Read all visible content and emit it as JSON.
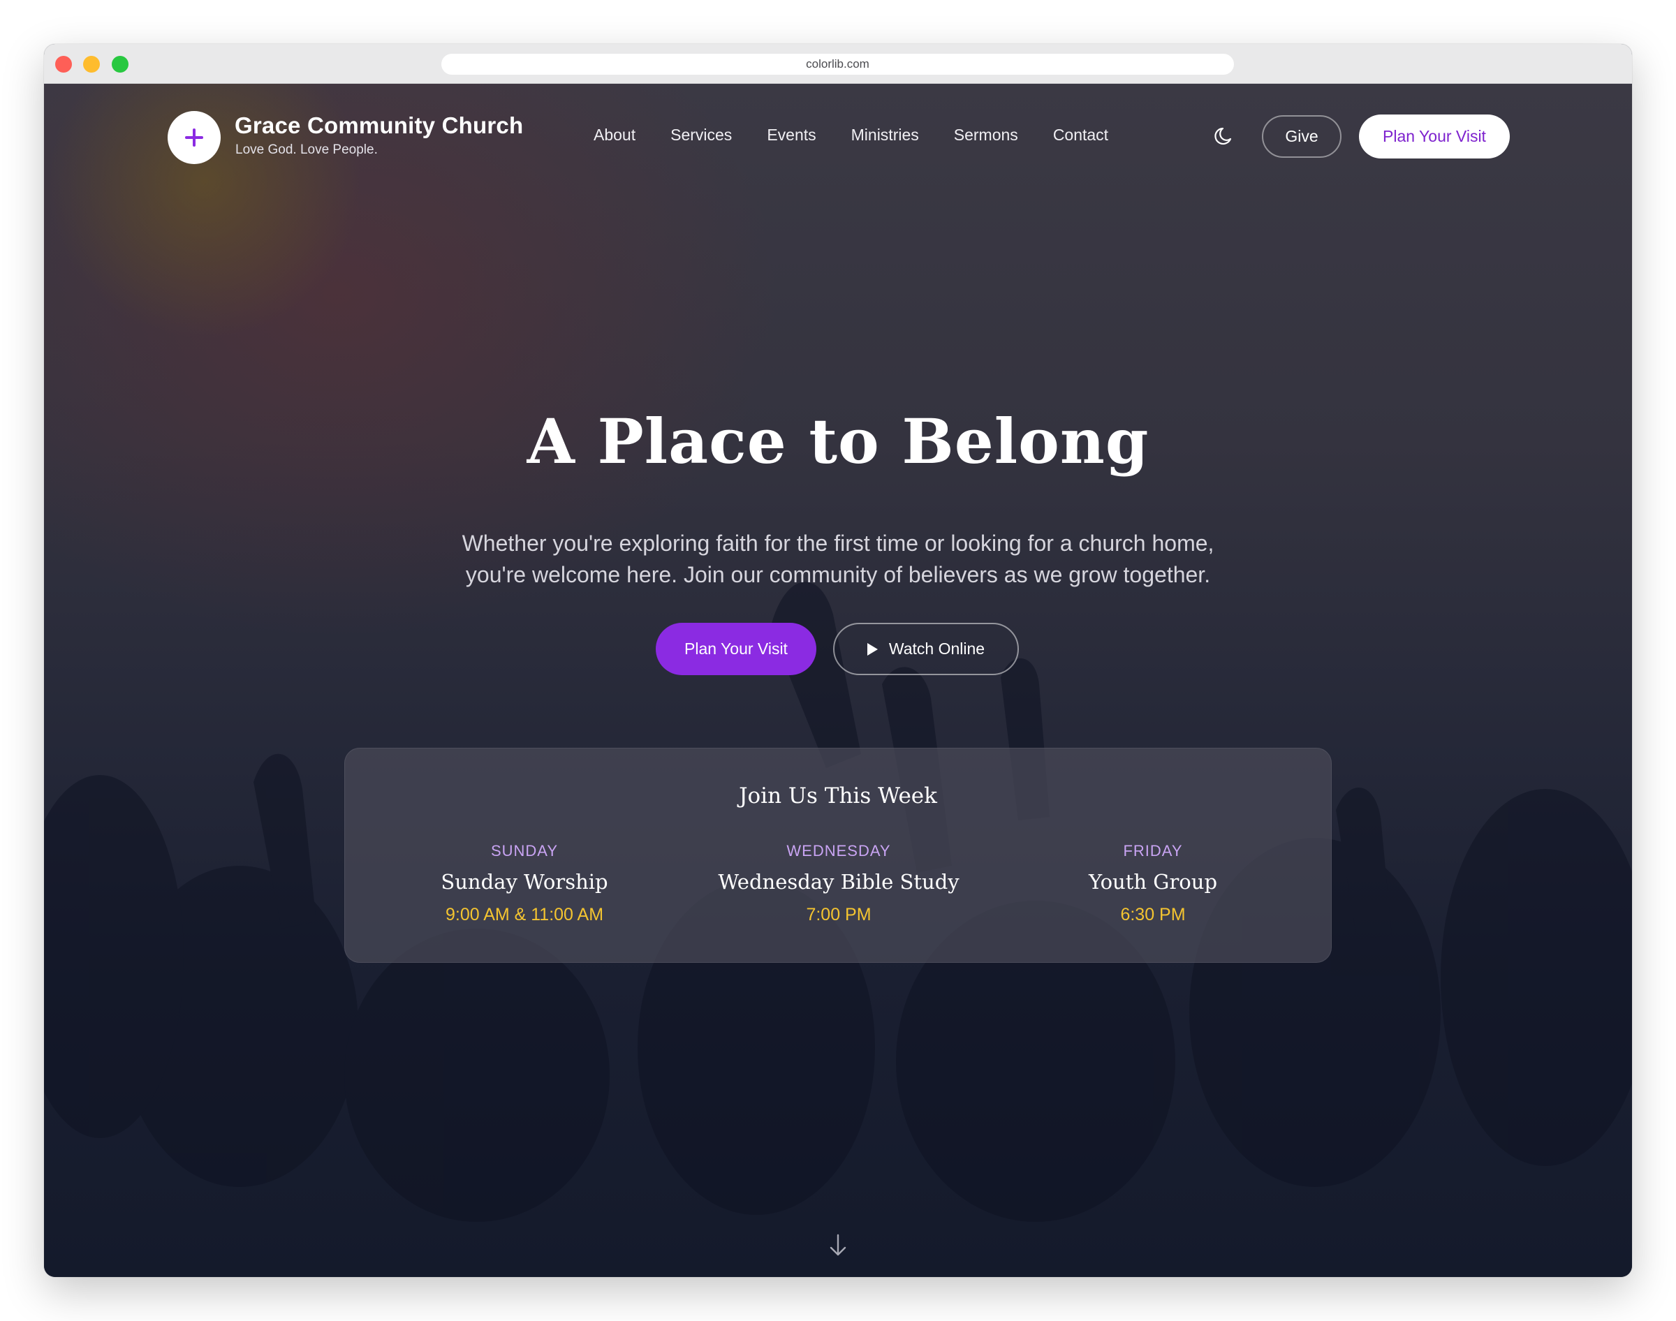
{
  "browser": {
    "url": "colorlib.com"
  },
  "brand": {
    "name": "Grace Community Church",
    "tagline": "Love God. Love People."
  },
  "nav": {
    "items": [
      "About",
      "Services",
      "Events",
      "Ministries",
      "Sermons",
      "Contact"
    ],
    "give_label": "Give",
    "plan_visit_label": "Plan Your Visit"
  },
  "hero": {
    "headline": "A Place to Belong",
    "subtext_line1": "Whether you're exploring faith for the first time or looking for a church home,",
    "subtext_line2": "you're welcome here. Join our community of believers as we grow together.",
    "primary_button": "Plan Your Visit",
    "secondary_button": "Watch Online"
  },
  "schedule": {
    "title": "Join Us This Week",
    "items": [
      {
        "day": "SUNDAY",
        "event": "Sunday Worship",
        "time": "9:00 AM & 11:00 AM"
      },
      {
        "day": "WEDNESDAY",
        "event": "Wednesday Bible Study",
        "time": "7:00 PM"
      },
      {
        "day": "FRIDAY",
        "event": "Youth Group",
        "time": "6:30 PM"
      }
    ]
  },
  "colors": {
    "accent": "#8b2be2",
    "accent_text": "#7e22ce",
    "day_label": "#c9a4f3",
    "time_text": "#f4c430",
    "background_dark": "#151a2b"
  },
  "icons": [
    "cross-icon",
    "moon-icon",
    "play-icon",
    "arrow-down-icon"
  ]
}
